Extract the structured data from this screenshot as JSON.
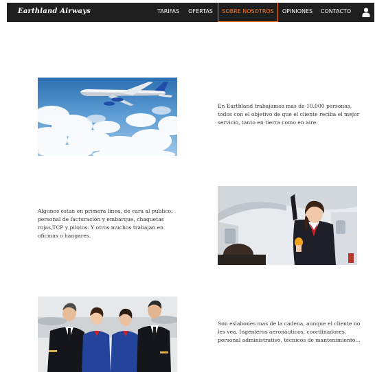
{
  "brand": "Earthland Airways",
  "nav": {
    "items": [
      {
        "label": "TARIFAS"
      },
      {
        "label": "OFERTAS"
      },
      {
        "label": "SOBRE NOSOTROS"
      },
      {
        "label": "OPINIONES"
      },
      {
        "label": "CONTACTO"
      }
    ],
    "active_color": "#ff7a1a"
  },
  "sections": [
    {
      "text": "En Earthland trabajamos mas de 10.000 personas, todos con el objetivo de que el cliente reciba el mejor servicio, tanto en tierra como en aire."
    },
    {
      "text": "Algunos estan en primera línea, de cara al público: personal de facturación y embarque, chaquetas rojas,TCP y pilotos. Y otros muchos trabajan en oficinas o hangares."
    },
    {
      "text": "Son eslabones mas de la cadena, aunque el cliente no les vea. Ingenieros aeronáuticos, coordinadores, personal administrativo, técnicos de mantenimiento..."
    }
  ]
}
